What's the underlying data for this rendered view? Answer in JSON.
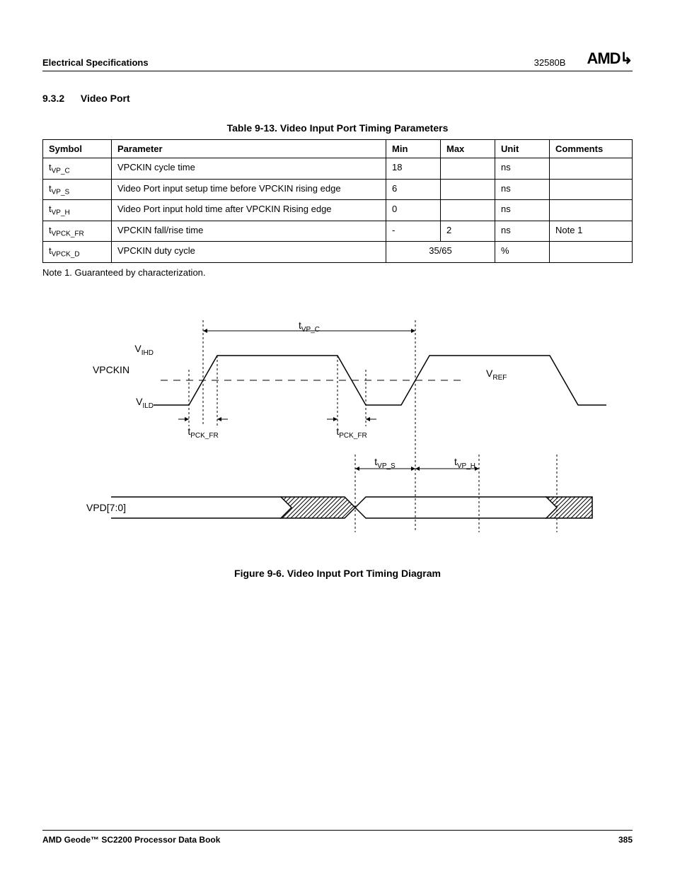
{
  "header": {
    "section": "Electrical Specifications",
    "doc_code": "32580B",
    "logo_text": "AMD"
  },
  "section": {
    "number": "9.3.2",
    "title": "Video Port"
  },
  "table": {
    "caption": "Table 9-13.  Video Input Port Timing Parameters",
    "headers": [
      "Symbol",
      "Parameter",
      "Min",
      "Max",
      "Unit",
      "Comments"
    ],
    "rows": [
      {
        "sym_base": "t",
        "sym_sub": "VP_C",
        "param": "VPCKIN cycle time",
        "min": "18",
        "max": "",
        "unit": "ns",
        "comments": ""
      },
      {
        "sym_base": "t",
        "sym_sub": "VP_S",
        "param": "Video Port input setup time before VPCKIN rising edge",
        "min": "6",
        "max": "",
        "unit": "ns",
        "comments": ""
      },
      {
        "sym_base": "t",
        "sym_sub": "VP_H",
        "param": "Video Port input hold time after VPCKIN Rising edge",
        "min": "0",
        "max": "",
        "unit": "ns",
        "comments": ""
      },
      {
        "sym_base": "t",
        "sym_sub": "VPCK_FR",
        "param": "VPCKIN fall/rise time",
        "min": "-",
        "max": "2",
        "unit": "ns",
        "comments": "Note 1"
      },
      {
        "sym_base": "t",
        "sym_sub": "VPCK_D",
        "param": "VPCKIN duty cycle",
        "min": "35/65",
        "max": "_merged_",
        "unit": "%",
        "comments": ""
      }
    ],
    "note": "Note 1.   Guaranteed by characterization."
  },
  "figure": {
    "caption": "Figure 9-6.  Video Input Port Timing Diagram",
    "labels": {
      "vpckin": "VPCKIN",
      "vihd_base": "V",
      "vihd_sub": "IHD",
      "vild_base": "V",
      "vild_sub": "ILD",
      "vref_base": "V",
      "vref_sub": "REF",
      "tvp_c_base": "t",
      "tvp_c_sub": "VP_C",
      "tpck_fr_base": "t",
      "tpck_fr_sub": "PCK_FR",
      "tvp_s_base": "t",
      "tvp_s_sub": "VP_S",
      "tvp_h_base": "t",
      "tvp_h_sub": "VP_H",
      "vpd": "VPD[7:0]"
    }
  },
  "footer": {
    "book": "AMD Geode™ SC2200  Processor Data Book",
    "page": "385"
  }
}
